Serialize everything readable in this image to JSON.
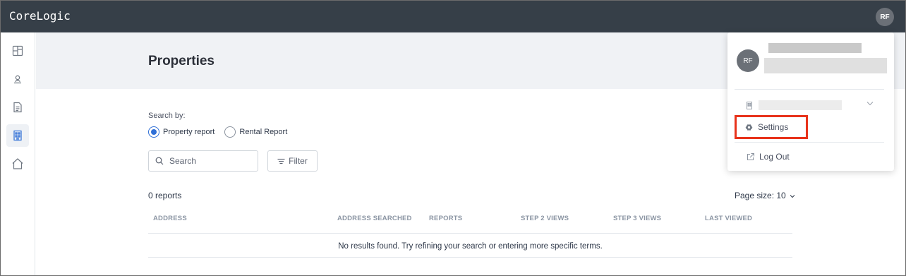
{
  "app": {
    "brand": "CoreLogic",
    "user_initials": "RF"
  },
  "sidebar": {
    "items": [
      {
        "icon": "dashboard-icon"
      },
      {
        "icon": "user-icon"
      },
      {
        "icon": "document-icon"
      },
      {
        "icon": "building-icon",
        "active": true
      },
      {
        "icon": "home-icon"
      }
    ]
  },
  "page": {
    "title": "Properties"
  },
  "search": {
    "label": "Search by:",
    "options": [
      {
        "label": "Property report",
        "selected": true
      },
      {
        "label": "Rental Report",
        "selected": false
      }
    ],
    "placeholder": "Search",
    "filter_label": "Filter"
  },
  "results": {
    "count_text": "0 reports",
    "page_size_text": "Page size: 10",
    "columns": [
      "ADDRESS",
      "ADDRESS SEARCHED",
      "REPORTS",
      "STEP 2 VIEWS",
      "STEP 3 VIEWS",
      "LAST VIEWED"
    ],
    "empty_message": "No results found. Try refining your search or entering more specific terms."
  },
  "user_menu": {
    "initials": "RF",
    "settings_label": "Settings",
    "logout_label": "Log Out",
    "highlight_color": "#e8331b"
  },
  "colors": {
    "topbar": "#363f48",
    "accent": "#2f6fd6",
    "header_bg": "#f0f2f5"
  }
}
